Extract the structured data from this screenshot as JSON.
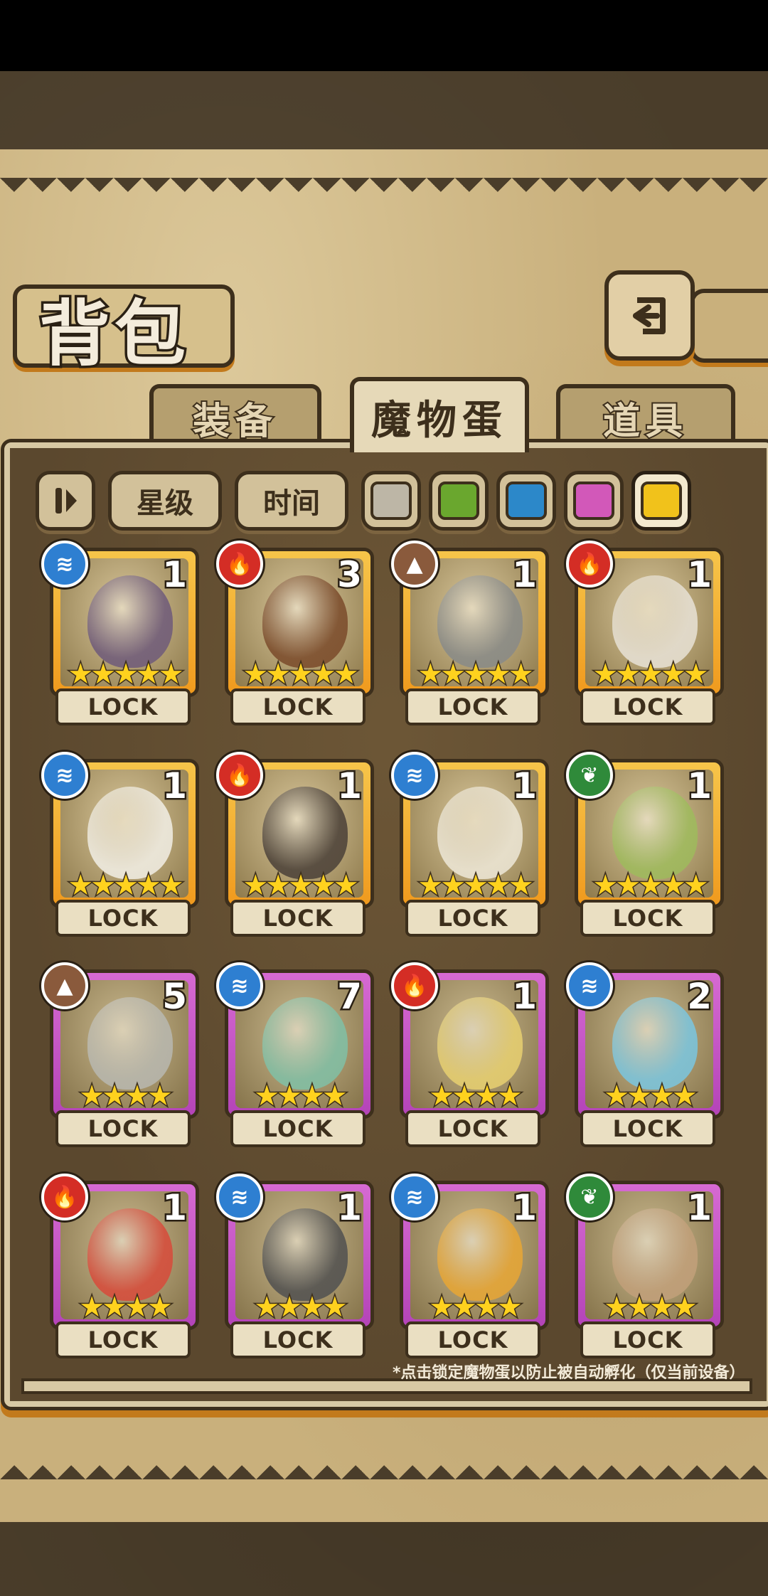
{
  "header": {
    "title": "背包"
  },
  "tabs": [
    {
      "label": "装备",
      "active": false
    },
    {
      "label": "魔物蛋",
      "active": true
    },
    {
      "label": "道具",
      "active": false
    }
  ],
  "sort": {
    "toggle_icon": "sort-toggle-icon",
    "star_label": "星级",
    "time_label": "时间"
  },
  "color_filters": [
    {
      "name": "white",
      "color": "#bdb6a6"
    },
    {
      "name": "green",
      "color": "#6aa72e"
    },
    {
      "name": "blue",
      "color": "#2c88c9"
    },
    {
      "name": "pink",
      "color": "#d258b9"
    },
    {
      "name": "gold",
      "color": "#f1c21b",
      "selected": true
    }
  ],
  "elements": {
    "water": {
      "color": "#2e7fd1",
      "glyph": "≋"
    },
    "fire": {
      "color": "#d42d25",
      "glyph": "🔥"
    },
    "earth": {
      "color": "#8a5a3c",
      "glyph": "▲"
    },
    "leaf": {
      "color": "#2f8a3a",
      "glyph": "❦"
    }
  },
  "eggs": [
    {
      "element": "water",
      "count": "1",
      "stars": 5,
      "rarity": "gold",
      "lock": "LOCK",
      "egg_color": "#6e5a7a"
    },
    {
      "element": "fire",
      "count": "3",
      "stars": 5,
      "rarity": "gold",
      "lock": "LOCK",
      "egg_color": "#7a4a2a"
    },
    {
      "element": "earth",
      "count": "1",
      "stars": 5,
      "rarity": "gold",
      "lock": "LOCK",
      "egg_color": "#888a88"
    },
    {
      "element": "fire",
      "count": "1",
      "stars": 5,
      "rarity": "gold",
      "lock": "LOCK",
      "egg_color": "#e8e2d6"
    },
    {
      "element": "water",
      "count": "1",
      "stars": 5,
      "rarity": "gold",
      "lock": "LOCK",
      "egg_color": "#f2efe6"
    },
    {
      "element": "fire",
      "count": "1",
      "stars": 5,
      "rarity": "gold",
      "lock": "LOCK",
      "egg_color": "#4a4038"
    },
    {
      "element": "water",
      "count": "1",
      "stars": 5,
      "rarity": "gold",
      "lock": "LOCK",
      "egg_color": "#eee8d8"
    },
    {
      "element": "leaf",
      "count": "1",
      "stars": 5,
      "rarity": "gold",
      "lock": "LOCK",
      "egg_color": "#9ebb5c"
    },
    {
      "element": "earth",
      "count": "5",
      "stars": 4,
      "rarity": "purple",
      "lock": "LOCK",
      "egg_color": "#b8b8b0"
    },
    {
      "element": "water",
      "count": "7",
      "stars": 4,
      "rarity": "purple",
      "lock": "LOCK",
      "egg_color": "#80c0a6"
    },
    {
      "element": "fire",
      "count": "1",
      "stars": 4,
      "rarity": "purple",
      "lock": "LOCK",
      "egg_color": "#e8d070"
    },
    {
      "element": "water",
      "count": "2",
      "stars": 4,
      "rarity": "purple",
      "lock": "LOCK",
      "egg_color": "#7ac6e0"
    },
    {
      "element": "fire",
      "count": "1",
      "stars": 4,
      "rarity": "purple",
      "lock": "LOCK",
      "egg_color": "#d84a3a"
    },
    {
      "element": "water",
      "count": "1",
      "stars": 4,
      "rarity": "purple",
      "lock": "LOCK",
      "egg_color": "#505050"
    },
    {
      "element": "water",
      "count": "1",
      "stars": 4,
      "rarity": "purple",
      "lock": "LOCK",
      "egg_color": "#e8a634"
    },
    {
      "element": "leaf",
      "count": "1",
      "stars": 4,
      "rarity": "purple",
      "lock": "LOCK",
      "egg_color": "#c2a07a"
    }
  ],
  "footnote": "*点击锁定魔物蛋以防止被自动孵化（仅当前设备）"
}
